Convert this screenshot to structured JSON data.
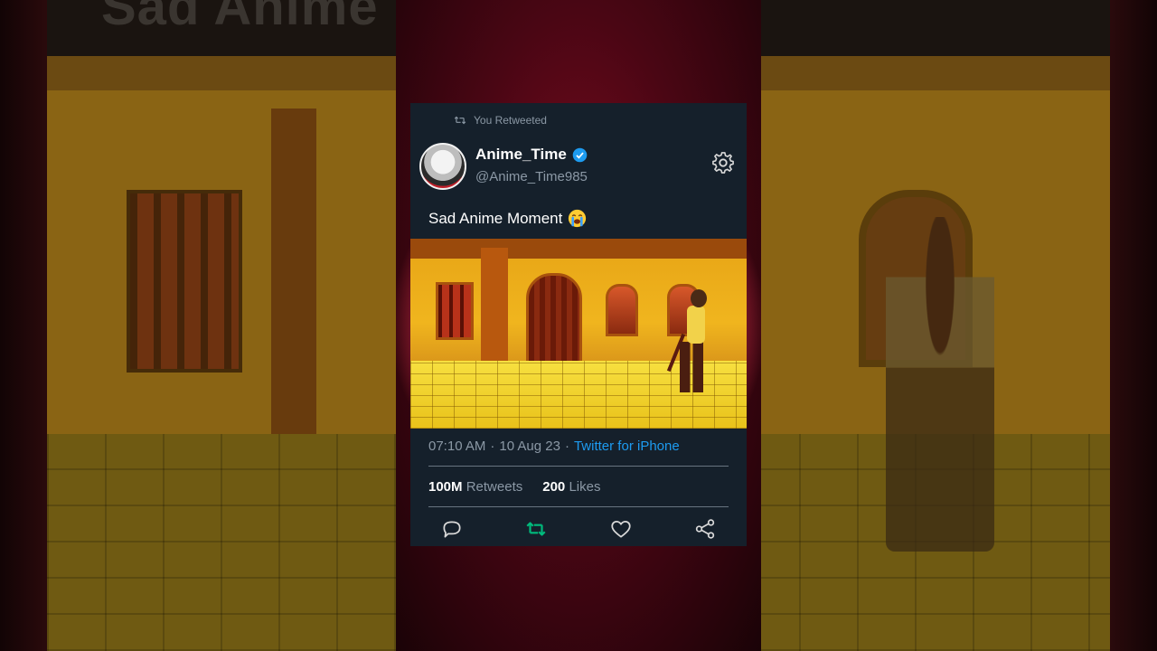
{
  "background": {
    "top_text": "Sad Anime "
  },
  "tweet": {
    "retweet_label": "You Retweeted",
    "display_name": "Anime_Time",
    "handle": "@Anime_Time985",
    "text": "Sad Anime Moment",
    "time": "07:10 AM",
    "date": "10 Aug 23",
    "source": "Twitter for iPhone",
    "separator": "·",
    "retweets_count": "100M",
    "retweets_label": "Retweets",
    "likes_count": "200",
    "likes_label": "Likes"
  },
  "icons": {
    "retweet_small": "retweet-icon",
    "verified": "verified-badge-icon",
    "settings": "gear-icon",
    "emoji": "loudly-crying-face-emoji",
    "reply": "reply-icon",
    "retweet": "retweet-icon",
    "like": "heart-icon",
    "share": "share-icon"
  },
  "colors": {
    "card_bg": "#15202b",
    "accent_blue": "#1d9bf0",
    "retweet_green": "#00ba7c",
    "muted_text": "#8b98a5"
  }
}
